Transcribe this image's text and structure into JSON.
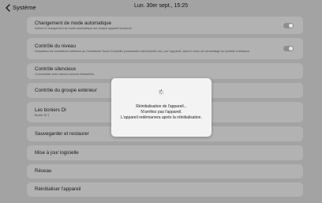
{
  "header": {
    "back_label": "Système",
    "datetime": "Lun. 30er sept., 15:25"
  },
  "settings": [
    {
      "title": "Changement de mode automatique",
      "description": "Activer le changement de mode automatique sur chaque appareil concerné",
      "toggle": true
    },
    {
      "title": "Contrôle du niveau",
      "description": "Désactivez les contrôleurs inférieurs au Centralized Touch Controller (commande marche/arrêt, etc.) sur l'appareil, dans le menu de verrouillage du contrôle à distance.",
      "toggle": true
    },
    {
      "title": "Contrôle silencieux",
      "description": "Commandes avec retours sonores désactivés."
    },
    {
      "title": "Contrôle du groupe extérieur",
      "description": ""
    },
    {
      "title": "Les boniers DI",
      "description": "Bonier DI 1"
    },
    {
      "title": "Sauvegarder et restaurer",
      "description": ""
    },
    {
      "title": "Mise à jour logicielle",
      "description": ""
    },
    {
      "title": "Réseau",
      "description": ""
    },
    {
      "title": "Réinitialiser l'appareil",
      "description": ""
    }
  ],
  "dialog": {
    "lines": [
      "Réinitialisation de l'appareil...",
      "N'arrêtez pas l'appareil.",
      "L'appareil redémarrera après la réinitialisation."
    ]
  }
}
